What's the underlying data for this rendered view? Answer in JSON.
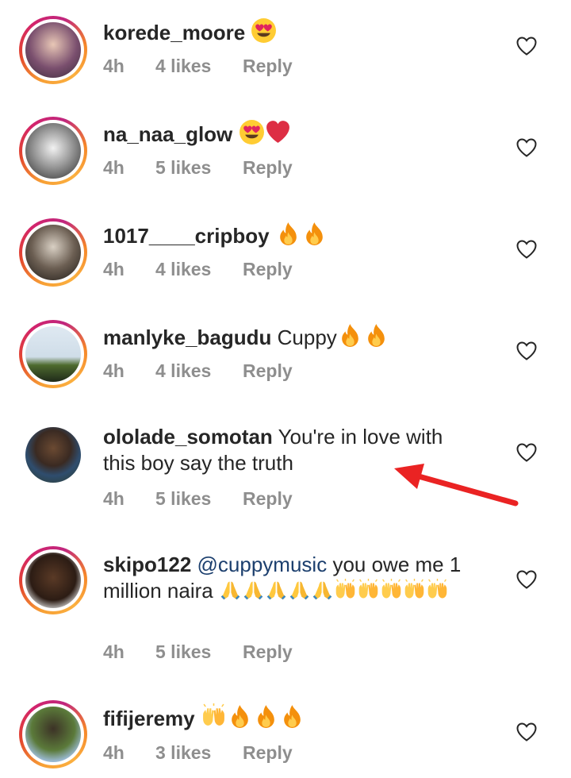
{
  "colors": {
    "text": "#262626",
    "meta": "#8e8e8e",
    "mention": "#1c3f6e",
    "arrow": "#ea2323"
  },
  "comments": [
    {
      "username": "korede_moore",
      "text": "",
      "emojis": [
        "heart-eyes"
      ],
      "time": "4h",
      "likes": "4 likes",
      "reply": "Reply",
      "story_ring": true
    },
    {
      "username": "na_naa_glow",
      "text": "",
      "emojis": [
        "heart-eyes",
        "red-heart"
      ],
      "time": "4h",
      "likes": "5 likes",
      "reply": "Reply",
      "story_ring": true
    },
    {
      "username": "1017____cripboy",
      "text": "",
      "emojis": [
        "fire",
        "fire"
      ],
      "time": "4h",
      "likes": "4 likes",
      "reply": "Reply",
      "story_ring": true
    },
    {
      "username": "manlyke_bagudu",
      "text": "Cuppy",
      "emojis": [
        "fire",
        "fire"
      ],
      "time": "4h",
      "likes": "4 likes",
      "reply": "Reply",
      "story_ring": true
    },
    {
      "username": "ololade_somotan",
      "text": "You're in love with this boy say the truth",
      "emojis": [],
      "time": "4h",
      "likes": "5 likes",
      "reply": "Reply",
      "story_ring": false
    },
    {
      "username": "skipo122",
      "mention": "@cuppymusic",
      "text": "you owe me 1 million naira",
      "emojis": [
        "folded-hands",
        "folded-hands",
        "folded-hands",
        "folded-hands",
        "folded-hands",
        "raising-hands",
        "raising-hands",
        "raising-hands",
        "raising-hands",
        "raising-hands"
      ],
      "time": "4h",
      "likes": "5 likes",
      "reply": "Reply",
      "story_ring": true
    },
    {
      "username": "fifijeremy",
      "text": "",
      "emojis": [
        "raising-hands",
        "fire",
        "fire",
        "fire"
      ],
      "time": "4h",
      "likes": "3 likes",
      "reply": "Reply",
      "story_ring": true
    }
  ],
  "icons": {
    "like": "heart-outline-icon",
    "annotation": "red-arrow"
  }
}
